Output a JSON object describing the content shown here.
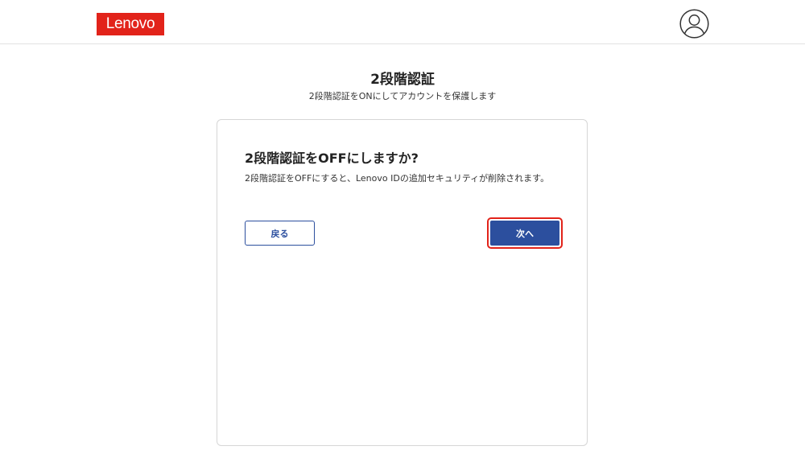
{
  "header": {
    "logo_text": "Lenovo",
    "brand_color": "#e2231a",
    "account_icon": "user-account-icon"
  },
  "page": {
    "title": "2段階認証",
    "subtitle": "2段階認証をONにしてアカウントを保護します"
  },
  "dialog": {
    "heading": "2段階認証をOFFにしますか?",
    "body": "2段階認証をOFFにすると、Lenovo IDの追加セキュリティが削除されます。",
    "back_label": "戻る",
    "next_label": "次へ",
    "primary_color": "#2c4f9e",
    "highlight_color": "#e2231a"
  }
}
